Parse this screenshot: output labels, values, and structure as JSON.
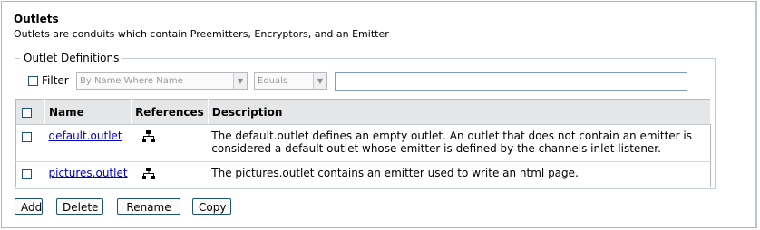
{
  "header": {
    "title": "Outlets",
    "subtitle": "Outlets are conduits which contain Preemitters, Encryptors, and an Emitter"
  },
  "definitions": {
    "legend": "Outlet Definitions",
    "filter": {
      "label": "Filter",
      "checked": false,
      "field_select": "By Name Where Name",
      "operator_select": "Equals",
      "value": ""
    },
    "table": {
      "columns": {
        "name": "Name",
        "references": "References",
        "description": "Description"
      },
      "rows": [
        {
          "name": "default.outlet",
          "description": "The default.outlet defines an empty outlet. An outlet that does not contain an emitter is considered a default outlet whose emitter is defined by the channels inlet listener."
        },
        {
          "name": "pictures.outlet",
          "description": "The pictures.outlet contains an emitter used to write an html page."
        }
      ]
    }
  },
  "actions": {
    "add": "Add",
    "delete": "Delete",
    "rename": "Rename",
    "copy": "Copy"
  }
}
